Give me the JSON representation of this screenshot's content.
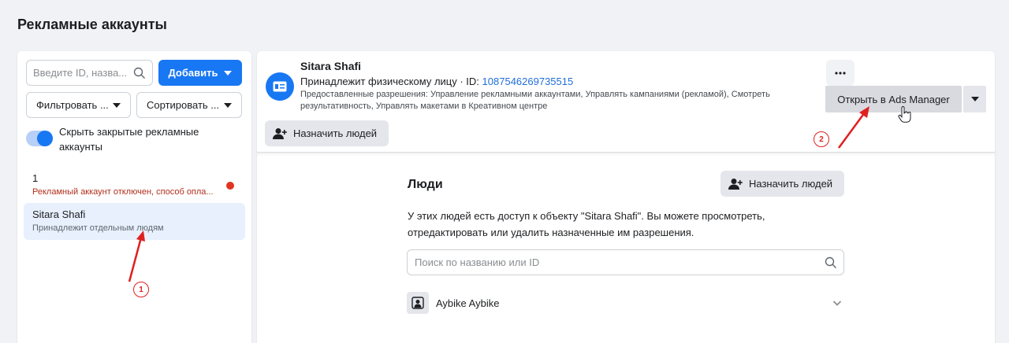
{
  "page": {
    "title": "Рекламные аккаунты"
  },
  "sidebar": {
    "search_placeholder": "Введите ID, назва...",
    "add_label": "Добавить",
    "filter_label": "Фильтровать ...",
    "sort_label": "Сортировать ...",
    "hide_closed_label": "Скрыть закрытые рекламные аккаунты",
    "hide_closed_on": true,
    "accounts": [
      {
        "name": "1",
        "subtitle": "Рекламный аккаунт отключен, способ опла...",
        "status": "error"
      },
      {
        "name": "Sitara Shafi",
        "subtitle": "Принадлежит отдельным людям",
        "status": "selected"
      }
    ]
  },
  "account": {
    "name": "Sitara Shafi",
    "owner_prefix": "Принадлежит физическому лицу · ID: ",
    "id": "1087546269735515",
    "permissions": "Предоставленные разрешения: Управление рекламными аккаунтами, Управлять кампаниями (рекламой), Смотреть результативность, Управлять макетами в Креативном центре",
    "assign_label": "Назначить людей",
    "open_ads_label": "Открыть в Ads Manager",
    "more_label": "..."
  },
  "people": {
    "title": "Люди",
    "assign_label": "Назначить людей",
    "description": "У этих людей есть доступ к объекту \"Sitara Shafi\". Вы можете просмотреть, отредактировать или удалить назначенные им разрешения.",
    "search_placeholder": "Поиск по названию или ID",
    "list": [
      {
        "name": "Aybike Aybike"
      }
    ]
  },
  "annotations": [
    {
      "label": "1"
    },
    {
      "label": "2"
    }
  ],
  "colors": {
    "primary": "#1877f2",
    "error": "#e0341e",
    "annotation": "#e02020",
    "selected_bg": "#e7f0fc"
  }
}
